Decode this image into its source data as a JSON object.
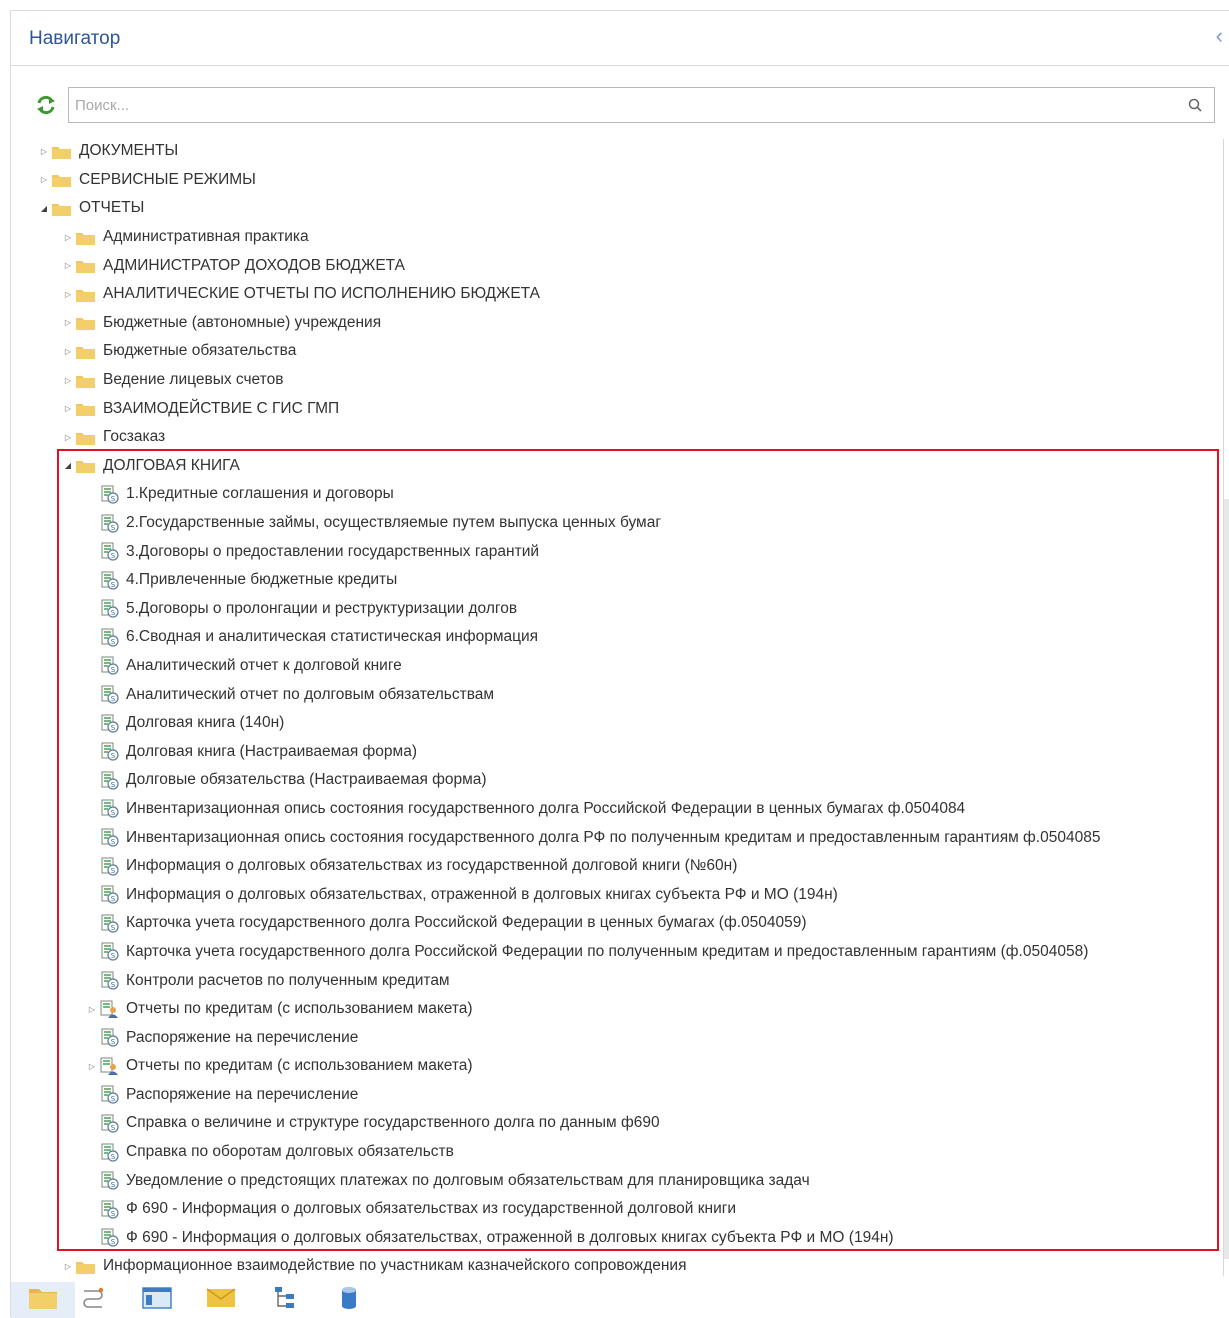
{
  "header": {
    "title": "Навигатор"
  },
  "search": {
    "placeholder": "Поиск..."
  },
  "tree": [
    {
      "label": "ДОКУМЕНТЫ",
      "level": 0,
      "type": "folder",
      "state": "collapsed"
    },
    {
      "label": "СЕРВИСНЫЕ РЕЖИМЫ",
      "level": 0,
      "type": "folder",
      "state": "collapsed"
    },
    {
      "label": "ОТЧЕТЫ",
      "level": 0,
      "type": "folder",
      "state": "expanded"
    },
    {
      "label": "Административная практика",
      "level": 1,
      "type": "folder",
      "state": "collapsed"
    },
    {
      "label": "АДМИНИСТРАТОР ДОХОДОВ БЮДЖЕТА",
      "level": 1,
      "type": "folder",
      "state": "collapsed"
    },
    {
      "label": "АНАЛИТИЧЕСКИЕ ОТЧЕТЫ ПО ИСПОЛНЕНИЮ БЮДЖЕТА",
      "level": 1,
      "type": "folder",
      "state": "collapsed"
    },
    {
      "label": "Бюджетные (автономные) учреждения",
      "level": 1,
      "type": "folder",
      "state": "collapsed"
    },
    {
      "label": "Бюджетные обязательства",
      "level": 1,
      "type": "folder",
      "state": "collapsed"
    },
    {
      "label": "Ведение лицевых счетов",
      "level": 1,
      "type": "folder",
      "state": "collapsed"
    },
    {
      "label": "ВЗАИМОДЕЙСТВИЕ С ГИС ГМП",
      "level": 1,
      "type": "folder",
      "state": "collapsed"
    },
    {
      "label": "Госзаказ",
      "level": 1,
      "type": "folder",
      "state": "collapsed"
    },
    {
      "label": "ДОЛГОВАЯ КНИГА",
      "level": 1,
      "type": "folder",
      "state": "expanded"
    },
    {
      "label": "1.Кредитные соглашения и договоры",
      "level": 2,
      "type": "report"
    },
    {
      "label": "2.Государственные займы, осуществляемые путем выпуска ценных бумаг",
      "level": 2,
      "type": "report"
    },
    {
      "label": "3.Договоры о предоставлении государственных гарантий",
      "level": 2,
      "type": "report"
    },
    {
      "label": "4.Привлеченные бюджетные кредиты",
      "level": 2,
      "type": "report"
    },
    {
      "label": "5.Договоры о пролонгации и реструктуризации долгов",
      "level": 2,
      "type": "report"
    },
    {
      "label": "6.Сводная и аналитическая статистическая информация",
      "level": 2,
      "type": "report"
    },
    {
      "label": "Аналитический отчет к долговой книге",
      "level": 2,
      "type": "report"
    },
    {
      "label": "Аналитический отчет по долговым обязательствам",
      "level": 2,
      "type": "report"
    },
    {
      "label": "Долговая книга (140н)",
      "level": 2,
      "type": "report"
    },
    {
      "label": "Долговая книга (Настраиваемая форма)",
      "level": 2,
      "type": "report"
    },
    {
      "label": "Долговые обязательства (Настраиваемая форма)",
      "level": 2,
      "type": "report"
    },
    {
      "label": "Инвентаризационная опись состояния государственного долга Российской Федерации в ценных бумагах ф.0504084",
      "level": 2,
      "type": "report"
    },
    {
      "label": "Инвентаризационная опись состояния государственного долга РФ по полученным кредитам и предоставленным гарантиям ф.0504085",
      "level": 2,
      "type": "report"
    },
    {
      "label": "Информация о долговых обязательствах из государственной долговой книги (№60н)",
      "level": 2,
      "type": "report"
    },
    {
      "label": "Информация о долговых обязательствах, отраженной в долговых книгах субъекта РФ и МО (194н)",
      "level": 2,
      "type": "report"
    },
    {
      "label": "Карточка учета государственного долга Российской Федерации в ценных бумагах (ф.0504059)",
      "level": 2,
      "type": "report"
    },
    {
      "label": "Карточка учета государственного долга Российской Федерации по полученным кредитам и предоставленным гарантиям (ф.0504058)",
      "level": 2,
      "type": "report"
    },
    {
      "label": "Контроли расчетов по полученным кредитам",
      "level": 2,
      "type": "report"
    },
    {
      "label": "Отчеты по кредитам (с использованием макета)",
      "level": 2,
      "type": "report-group",
      "state": "collapsed"
    },
    {
      "label": "Распоряжение на перечисление",
      "level": 2,
      "type": "report"
    },
    {
      "label": "Отчеты по кредитам (с использованием макета)",
      "level": 2,
      "type": "report-group",
      "state": "collapsed"
    },
    {
      "label": "Распоряжение на перечисление",
      "level": 2,
      "type": "report"
    },
    {
      "label": "Справка о величине и структуре государственного долга по данным ф690",
      "level": 2,
      "type": "report"
    },
    {
      "label": "Справка по оборотам долговых обязательств",
      "level": 2,
      "type": "report"
    },
    {
      "label": "Уведомление о предстоящих платежах по долговым обязательствам для планировщика задач",
      "level": 2,
      "type": "report"
    },
    {
      "label": "Ф 690 - Информация о долговых обязательствах из государственной долговой книги",
      "level": 2,
      "type": "report"
    },
    {
      "label": "Ф 690 - Информация о долговых обязательствах, отраженной в долговых книгах субъекта РФ и МО (194н)",
      "level": 2,
      "type": "report"
    },
    {
      "label": "Информационное взаимодействие по участникам казначейского сопровождения",
      "level": 1,
      "type": "folder",
      "state": "collapsed"
    }
  ],
  "toolbar": [
    {
      "icon": "folder-icon",
      "active": true
    },
    {
      "icon": "workflow-icon",
      "active": false
    },
    {
      "icon": "window-icon",
      "active": false
    },
    {
      "icon": "mail-icon",
      "active": false
    },
    {
      "icon": "tree-structure-icon",
      "active": false
    },
    {
      "icon": "database-icon",
      "active": false
    }
  ],
  "colors": {
    "accent": "#2b5797",
    "highlight_border": "#e0121e",
    "folder": "#f0c75e"
  }
}
